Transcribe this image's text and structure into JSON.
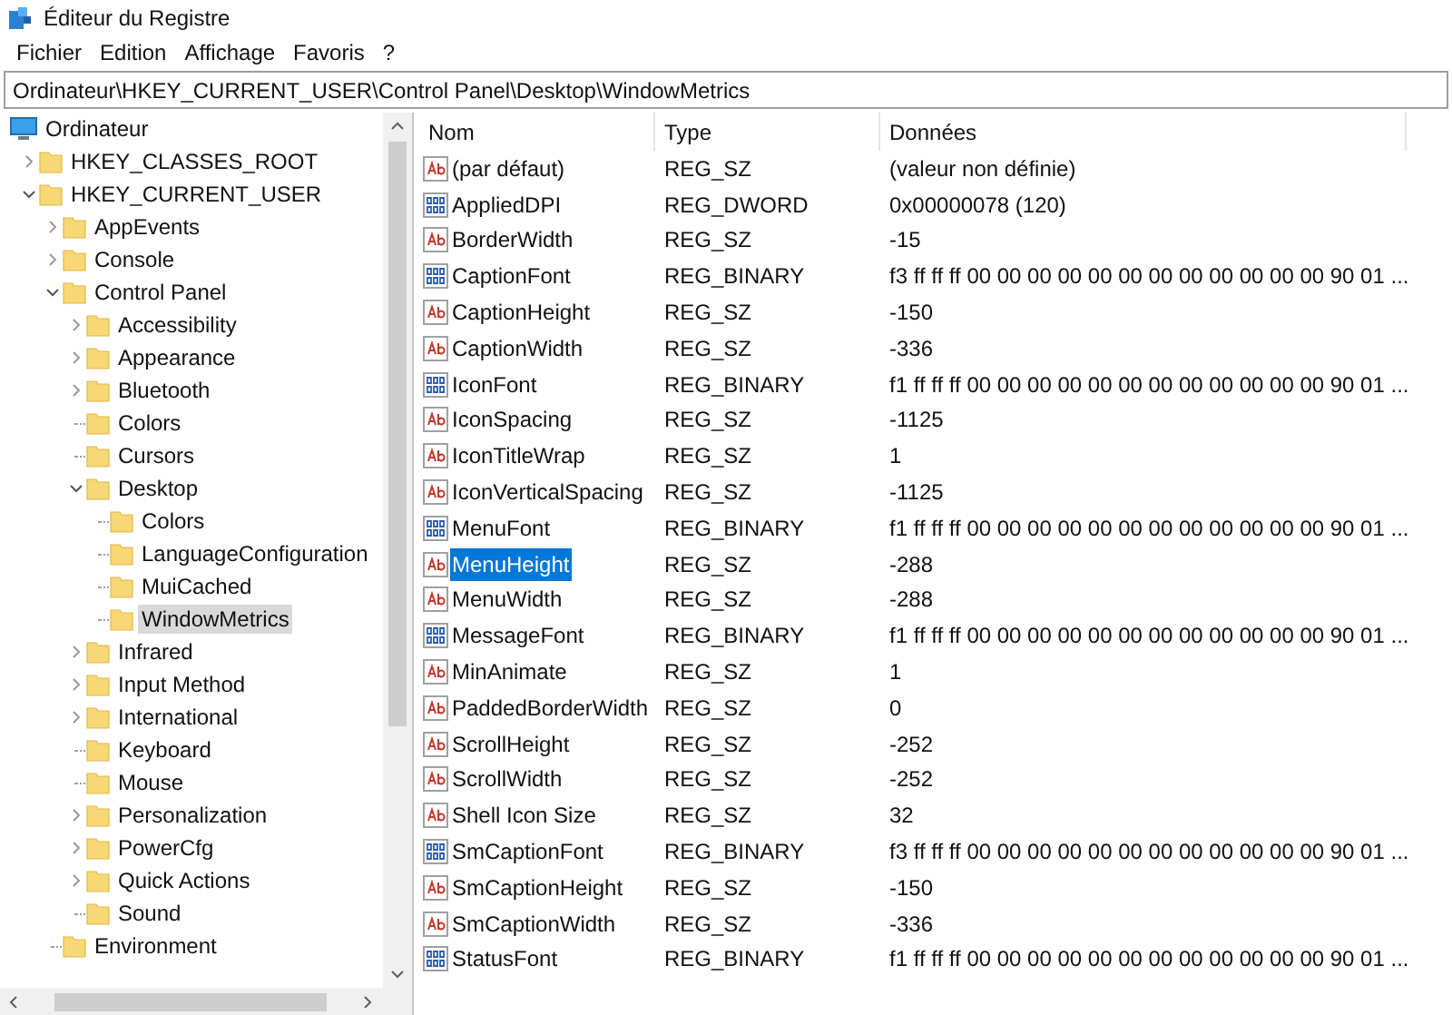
{
  "window": {
    "title": "Éditeur du Registre"
  },
  "menu": [
    "Fichier",
    "Edition",
    "Affichage",
    "Favoris",
    "?"
  ],
  "address": "Ordinateur\\HKEY_CURRENT_USER\\Control Panel\\Desktop\\WindowMetrics",
  "tree": [
    {
      "label": "Ordinateur",
      "kind": "computer",
      "selected": false,
      "children": [
        {
          "label": "HKEY_CLASSES_ROOT",
          "kind": "branch",
          "expanded": false,
          "selected": false
        },
        {
          "label": "HKEY_CURRENT_USER",
          "kind": "branch",
          "expanded": true,
          "selected": false,
          "children": [
            {
              "label": "AppEvents",
              "kind": "branch",
              "expanded": false,
              "selected": false
            },
            {
              "label": "Console",
              "kind": "branch",
              "expanded": false,
              "selected": false
            },
            {
              "label": "Control Panel",
              "kind": "branch",
              "expanded": true,
              "selected": false,
              "children": [
                {
                  "label": "Accessibility",
                  "kind": "branch",
                  "expanded": false,
                  "selected": false
                },
                {
                  "label": "Appearance",
                  "kind": "branch",
                  "expanded": false,
                  "selected": false
                },
                {
                  "label": "Bluetooth",
                  "kind": "branch",
                  "expanded": false,
                  "selected": false
                },
                {
                  "label": "Colors",
                  "kind": "leaf",
                  "expanded": false,
                  "selected": false
                },
                {
                  "label": "Cursors",
                  "kind": "leaf",
                  "expanded": false,
                  "selected": false
                },
                {
                  "label": "Desktop",
                  "kind": "branch",
                  "expanded": true,
                  "selected": false,
                  "children": [
                    {
                      "label": "Colors",
                      "kind": "leaf",
                      "expanded": false,
                      "selected": false
                    },
                    {
                      "label": "LanguageConfiguration",
                      "kind": "leaf",
                      "expanded": false,
                      "selected": false
                    },
                    {
                      "label": "MuiCached",
                      "kind": "leaf",
                      "expanded": false,
                      "selected": false
                    },
                    {
                      "label": "WindowMetrics",
                      "kind": "leaf",
                      "expanded": false,
                      "selected": true
                    }
                  ]
                },
                {
                  "label": "Infrared",
                  "kind": "branch",
                  "expanded": false,
                  "selected": false
                },
                {
                  "label": "Input Method",
                  "kind": "branch",
                  "expanded": false,
                  "selected": false
                },
                {
                  "label": "International",
                  "kind": "branch",
                  "expanded": false,
                  "selected": false
                },
                {
                  "label": "Keyboard",
                  "kind": "leaf",
                  "expanded": false,
                  "selected": false
                },
                {
                  "label": "Mouse",
                  "kind": "leaf",
                  "expanded": false,
                  "selected": false
                },
                {
                  "label": "Personalization",
                  "kind": "branch",
                  "expanded": false,
                  "selected": false
                },
                {
                  "label": "PowerCfg",
                  "kind": "branch",
                  "expanded": false,
                  "selected": false
                },
                {
                  "label": "Quick Actions",
                  "kind": "branch",
                  "expanded": false,
                  "selected": false
                },
                {
                  "label": "Sound",
                  "kind": "leaf",
                  "expanded": false,
                  "selected": false
                }
              ]
            },
            {
              "label": "Environment",
              "kind": "leaf",
              "expanded": false,
              "selected": false
            }
          ]
        }
      ]
    }
  ],
  "table": {
    "columns": [
      "Nom",
      "Type",
      "Données"
    ],
    "rows": [
      {
        "name": "(par défaut)",
        "type": "REG_SZ",
        "data": "(valeur non définie)",
        "kind": "string",
        "selected": false
      },
      {
        "name": "AppliedDPI",
        "type": "REG_DWORD",
        "data": "0x00000078 (120)",
        "kind": "binary",
        "selected": false
      },
      {
        "name": "BorderWidth",
        "type": "REG_SZ",
        "data": "-15",
        "kind": "string",
        "selected": false
      },
      {
        "name": "CaptionFont",
        "type": "REG_BINARY",
        "data": "f3 ff ff ff 00 00 00 00 00 00 00 00 00 00 00 00 90 01 ...",
        "kind": "binary",
        "selected": false
      },
      {
        "name": "CaptionHeight",
        "type": "REG_SZ",
        "data": "-150",
        "kind": "string",
        "selected": false
      },
      {
        "name": "CaptionWidth",
        "type": "REG_SZ",
        "data": "-336",
        "kind": "string",
        "selected": false
      },
      {
        "name": "IconFont",
        "type": "REG_BINARY",
        "data": "f1 ff ff ff 00 00 00 00 00 00 00 00 00 00 00 00 90 01 ...",
        "kind": "binary",
        "selected": false
      },
      {
        "name": "IconSpacing",
        "type": "REG_SZ",
        "data": "-1125",
        "kind": "string",
        "selected": false
      },
      {
        "name": "IconTitleWrap",
        "type": "REG_SZ",
        "data": "1",
        "kind": "string",
        "selected": false
      },
      {
        "name": "IconVerticalSpacing",
        "type": "REG_SZ",
        "data": "-1125",
        "kind": "string",
        "selected": false
      },
      {
        "name": "MenuFont",
        "type": "REG_BINARY",
        "data": "f1 ff ff ff 00 00 00 00 00 00 00 00 00 00 00 00 90 01 ...",
        "kind": "binary",
        "selected": false
      },
      {
        "name": "MenuHeight",
        "type": "REG_SZ",
        "data": "-288",
        "kind": "string",
        "selected": true
      },
      {
        "name": "MenuWidth",
        "type": "REG_SZ",
        "data": "-288",
        "kind": "string",
        "selected": false
      },
      {
        "name": "MessageFont",
        "type": "REG_BINARY",
        "data": "f1 ff ff ff 00 00 00 00 00 00 00 00 00 00 00 00 90 01 ...",
        "kind": "binary",
        "selected": false
      },
      {
        "name": "MinAnimate",
        "type": "REG_SZ",
        "data": "1",
        "kind": "string",
        "selected": false
      },
      {
        "name": "PaddedBorderWidth",
        "type": "REG_SZ",
        "data": "0",
        "kind": "string",
        "selected": false
      },
      {
        "name": "ScrollHeight",
        "type": "REG_SZ",
        "data": "-252",
        "kind": "string",
        "selected": false
      },
      {
        "name": "ScrollWidth",
        "type": "REG_SZ",
        "data": "-252",
        "kind": "string",
        "selected": false
      },
      {
        "name": "Shell Icon Size",
        "type": "REG_SZ",
        "data": "32",
        "kind": "string",
        "selected": false
      },
      {
        "name": "SmCaptionFont",
        "type": "REG_BINARY",
        "data": "f3 ff ff ff 00 00 00 00 00 00 00 00 00 00 00 00 90 01 ...",
        "kind": "binary",
        "selected": false
      },
      {
        "name": "SmCaptionHeight",
        "type": "REG_SZ",
        "data": "-150",
        "kind": "string",
        "selected": false
      },
      {
        "name": "SmCaptionWidth",
        "type": "REG_SZ",
        "data": "-336",
        "kind": "string",
        "selected": false
      },
      {
        "name": "StatusFont",
        "type": "REG_BINARY",
        "data": "f1 ff ff ff 00 00 00 00 00 00 00 00 00 00 00 00 90 01 ...",
        "kind": "binary",
        "selected": false
      }
    ]
  }
}
